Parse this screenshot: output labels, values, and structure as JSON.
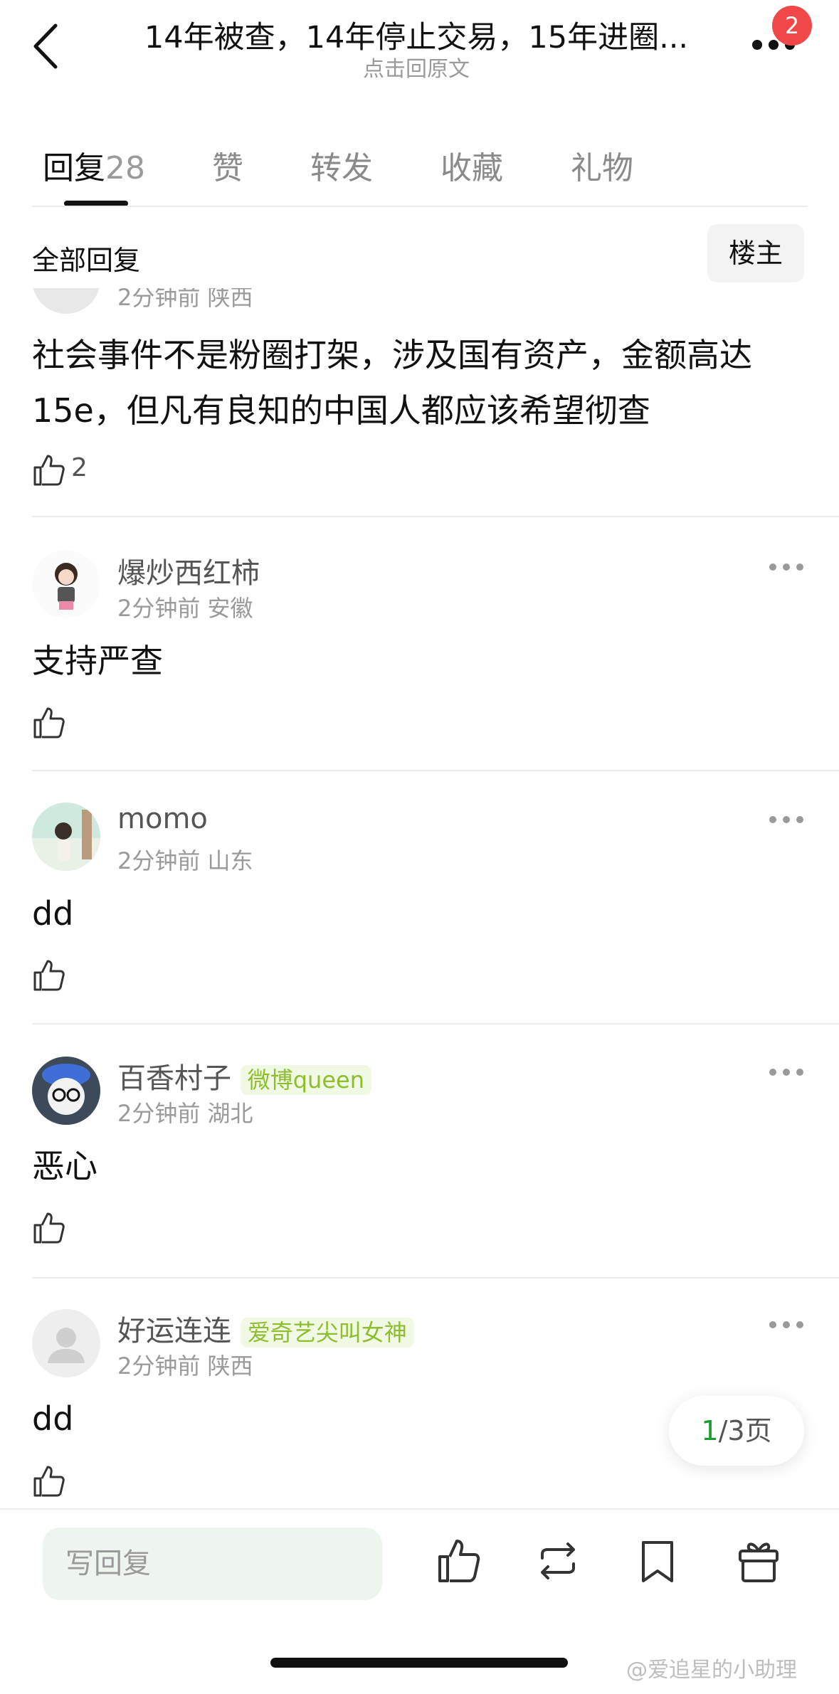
{
  "header": {
    "title": "14年被查，14年停止交易，15年进圈...",
    "subtitle": "点击回原文",
    "notification_count": "2"
  },
  "tabs": [
    {
      "label": "回复",
      "count": "28"
    },
    {
      "label": "赞"
    },
    {
      "label": "转发"
    },
    {
      "label": "收藏"
    },
    {
      "label": "礼物"
    }
  ],
  "filter": {
    "all_label": "全部回复",
    "owner_label": "楼主"
  },
  "comments": [
    {
      "meta": "2分钟前 陕西",
      "text_line1": "社会事件不是粉圈打架，涉及国有资产，金额高达",
      "text_line2": "15e，但凡有良知的中国人都应该希望彻查",
      "likes": "2"
    },
    {
      "username": "爆炒西红柿",
      "time": "2分钟前",
      "location": "安徽",
      "text": "支持严查"
    },
    {
      "username": "momo",
      "time": "2分钟前",
      "location": "山东",
      "text": "dd"
    },
    {
      "username": "百香村子",
      "tag": "微博queen",
      "time": "2分钟前",
      "location": "湖北",
      "text": "恶心"
    },
    {
      "username": "好运连连",
      "tag": "爱奇艺尖叫女神",
      "time": "2分钟前",
      "location": "陕西",
      "text": "dd"
    }
  ],
  "pager": {
    "current": "1",
    "rest": "/3页"
  },
  "bottom": {
    "reply_placeholder": "写回复"
  },
  "watermark": "@爱追星的小助理",
  "colors": {
    "accent_green": "#1a9c2e",
    "tag_green": "#8cbf2e",
    "badge_red": "#f04848"
  }
}
